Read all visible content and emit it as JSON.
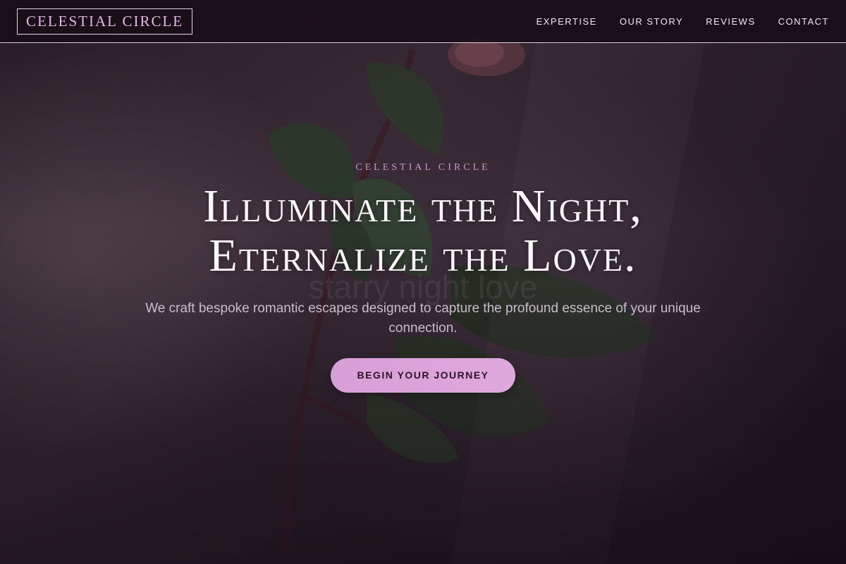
{
  "brand": {
    "logo_text": "CELESTIAL CIRCLE"
  },
  "nav": {
    "items": [
      {
        "label": "EXPERTISE"
      },
      {
        "label": "OUR STORY"
      },
      {
        "label": "REVIEWS"
      },
      {
        "label": "CONTACT"
      }
    ]
  },
  "hero": {
    "eyebrow": "CELESTIAL CIRCLE",
    "headline_line1": "Illuminate the Night,",
    "headline_line2": "Eternalize the Love.",
    "ghost_text": "starry night love",
    "subtext": "We craft bespoke romantic escapes designed to capture the profound essence of your unique connection.",
    "cta_label": "BEGIN YOUR JOURNEY"
  },
  "colors": {
    "accent": "#d89ed6",
    "eyebrow": "#cc93c9",
    "background": "#1f141d"
  }
}
